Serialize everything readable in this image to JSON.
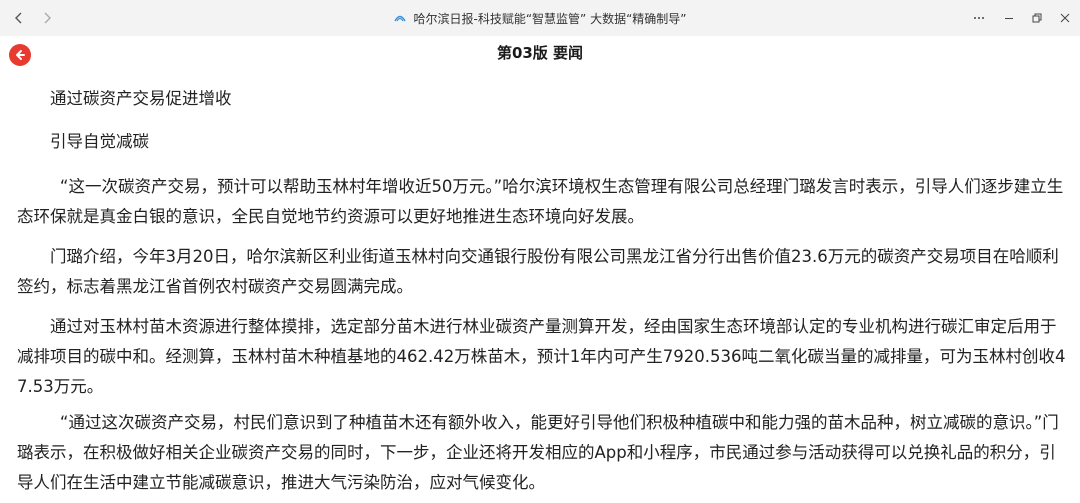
{
  "window": {
    "title": "哈尔滨日报-科技赋能“智慧监管” 大数据“精确制导”",
    "icons": {
      "back": "chevron-left-icon",
      "forward": "chevron-right-icon",
      "app": "app-logo-icon",
      "more": "more-icon",
      "minimize": "minimize-icon",
      "restore": "restore-icon",
      "close": "close-icon"
    }
  },
  "header": {
    "title": "第03版 要闻",
    "back_icon": "arrow-left-circle-icon",
    "accent": "#e83a2e"
  },
  "article": {
    "heading1": "通过碳资产交易促进增收",
    "heading2": "引导自觉减碳",
    "p1": "“这一次碳资产交易，预计可以帮助玉林村年增收近50万元。”哈尔滨环境权生态管理有限公司总经理门璐发言时表示，引导人们逐步建立生态环保就是真金白银的意识，全民自觉地节约资源可以更好地推进生态环境向好发展。",
    "p2": "门璐介绍，今年3月20日，哈尔滨新区利业街道玉林村向交通银行股份有限公司黑龙江省分行出售价值23.6万元的碳资产交易项目在哈顺利签约，标志着黑龙江省首例农村碳资产交易圆满完成。",
    "p3": "通过对玉林村苗木资源进行整体摸排，选定部分苗木进行林业碳资产量测算开发，经由国家生态环境部认定的专业机构进行碳汇审定后用于减排项目的碳中和。经测算，玉林村苗木种植基地的462.42万株苗木，预计1年内可产生7920.536吨二氧化碳当量的减排量，可为玉林村创收47.53万元。",
    "p4": "“通过这次碳资产交易，村民们意识到了种植苗木还有额外收入，能更好引导他们积极种植碳中和能力强的苗木品种，树立减碳的意识。”门璐表示，在积极做好相关企业碳资产交易的同时，下一步，企业还将开发相应的App和小程序，市民通过参与活动获得可以兑换礼品的积分，引导人们在生活中建立节能减碳意识，推进大气污染防治，应对气候变化。"
  }
}
